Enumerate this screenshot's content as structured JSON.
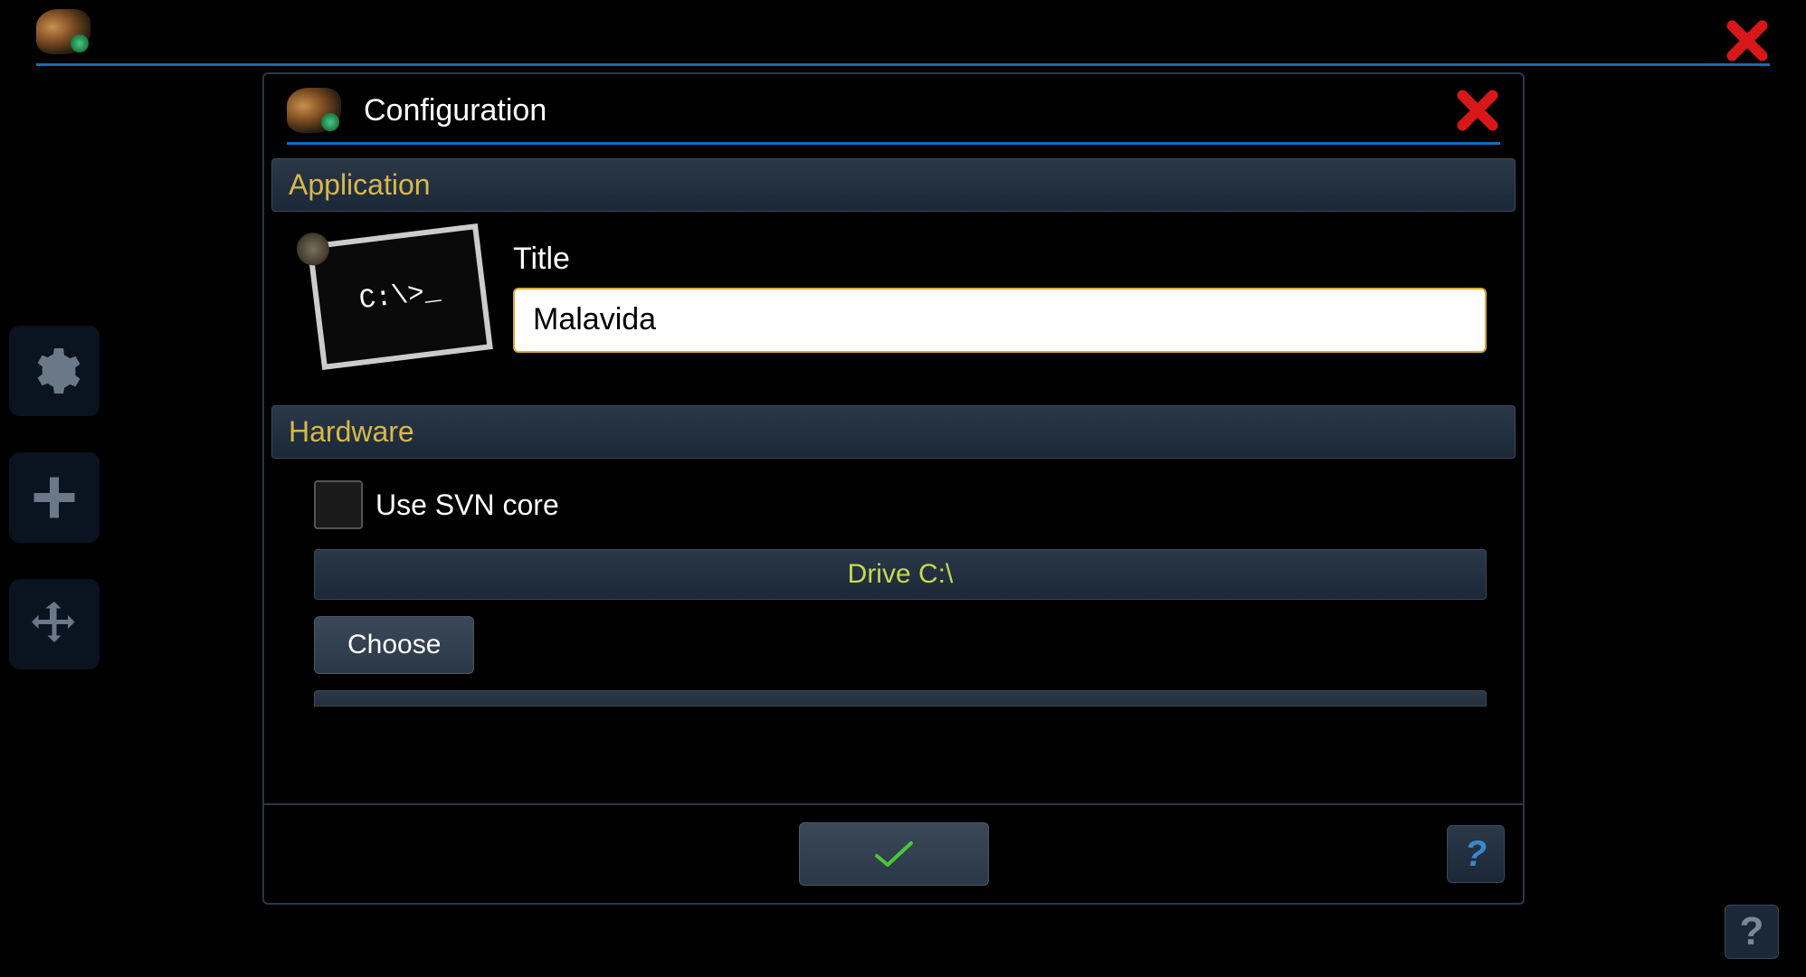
{
  "background": {
    "sidebar": {
      "settings_icon": "gear",
      "add_icon": "plus",
      "move_icon": "arrows"
    },
    "help_label": "?"
  },
  "dialog": {
    "title": "Configuration",
    "sections": {
      "application": {
        "title": "Application",
        "thumb_text": "C:\\>_",
        "field_label": "Title",
        "field_value": "Malavida"
      },
      "hardware": {
        "title": "Hardware",
        "svn_label": "Use SVN core",
        "svn_checked": false,
        "drive_label": "Drive C:\\",
        "choose_label": "Choose"
      }
    },
    "footer": {
      "help_label": "?"
    }
  }
}
